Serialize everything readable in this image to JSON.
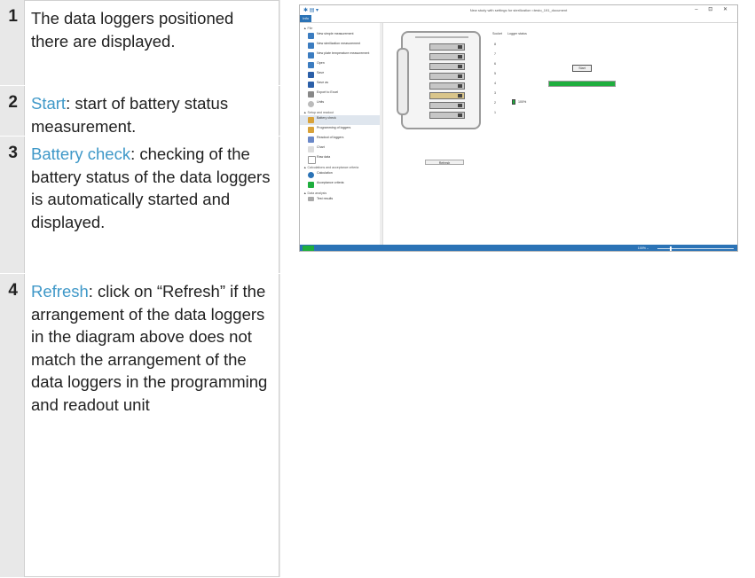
{
  "steps": [
    {
      "number": "1",
      "text": "The data loggers positioned there are displayed."
    },
    {
      "number": "2",
      "keyword": "Start",
      "text": ": start of battery status measurement."
    },
    {
      "number": "3",
      "keyword": "Battery check",
      "text": ": checking of the battery status of the data loggers is automatically started and displayed."
    },
    {
      "number": "4",
      "keyword": "Refresh",
      "text": ": click on “Refresh” if the arrangement of the data loggers in the diagram above does not match the arrangement of the data loggers in the programming and readout unit"
    }
  ],
  "screenshot": {
    "window_title": "New study with settings for sterilization <testo_191_document",
    "info_tab": "Info",
    "window_controls": "– ⊡ ✕",
    "menu": {
      "file_section": "▲ File",
      "file_items": [
        "New simple measurement",
        "New sterilization measurement",
        "New plate temperature measurement",
        "Open",
        "Save",
        "Save as",
        "Export to Excel",
        "Units"
      ],
      "setup_section": "▲ Setup and readout",
      "setup_items": [
        "Battery check",
        "Programming of loggers",
        "Readout of loggers",
        "Chart",
        "Raw data"
      ],
      "calc_section": "▲ Calculations and acceptance criteria",
      "calc_items": [
        "Calculation",
        "Acceptance criteria"
      ],
      "analysis_section": "▲ Data analysis",
      "analysis_items": [
        "Test results"
      ]
    },
    "slot_header": "Socket",
    "logger_header": "Logger status",
    "slots": [
      "8",
      "7",
      "6",
      "5",
      "4",
      "3",
      "2",
      "1"
    ],
    "start_label": "Start",
    "refresh_label": "Refresh",
    "progress": 1.0,
    "battery_value": "100%",
    "zoom": "100%  –"
  },
  "colors": {
    "keyword": "#3f98c8",
    "accent": "#2b73b6",
    "progress": "#1fae3e"
  }
}
